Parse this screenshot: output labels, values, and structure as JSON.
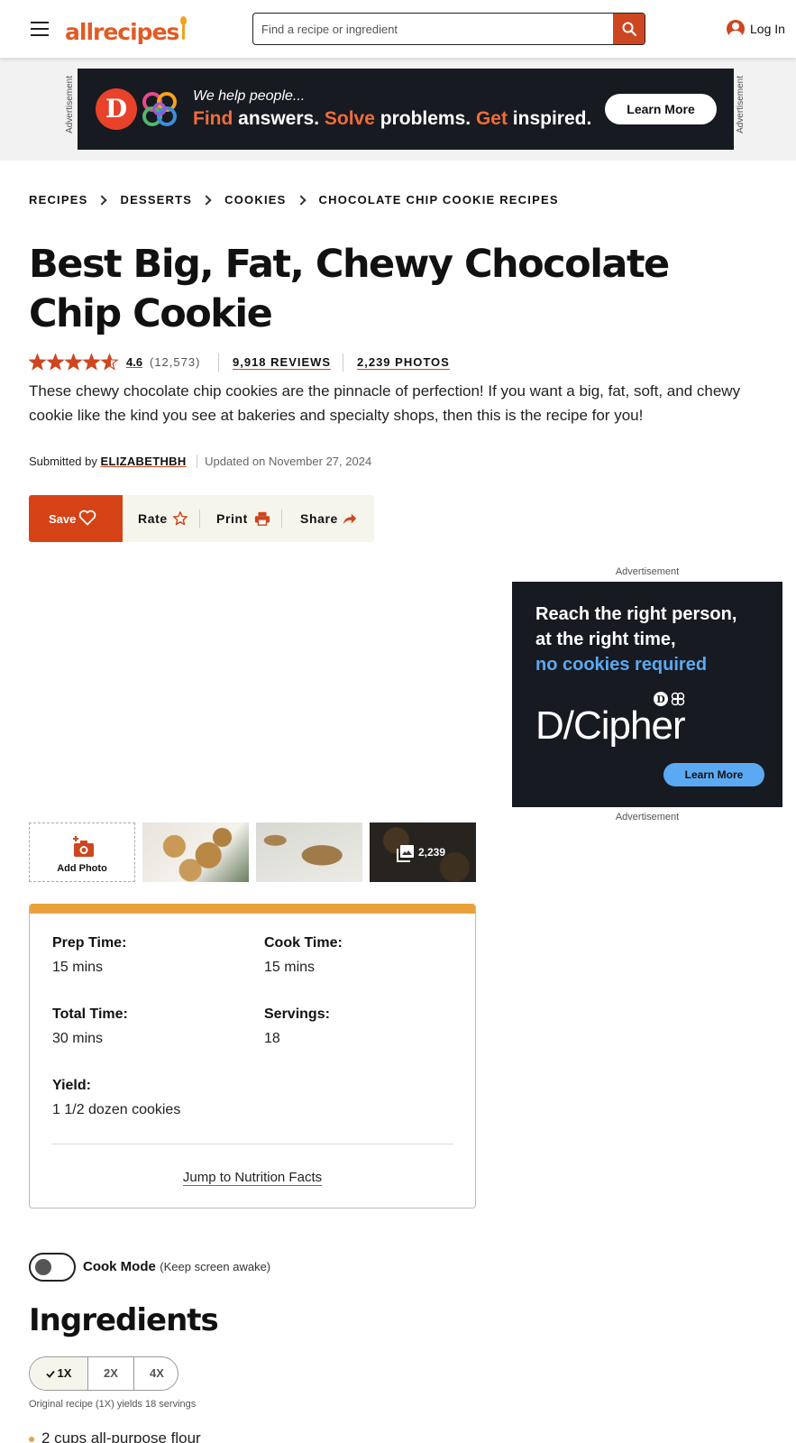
{
  "header": {
    "logo_text": "allrecipes",
    "search_placeholder": "Find a recipe or ingredient",
    "login_label": "Log In"
  },
  "top_ad": {
    "side_label": "Advertisement",
    "logo_letter": "D",
    "line1": "We help people...",
    "line2": {
      "find": "Find",
      "answers": " answers. ",
      "solve": "Solve",
      "problems": " problems. ",
      "get": "Get",
      "inspired": " inspired."
    },
    "button": "Learn More"
  },
  "breadcrumb": [
    "RECIPES",
    "DESSERTS",
    "COOKIES",
    "CHOCOLATE CHIP COOKIE RECIPES"
  ],
  "recipe": {
    "title": "Best Big, Fat, Chewy Chocolate Chip Cookie",
    "rating": "4.6",
    "rating_fraction": 0.92,
    "rating_count": "(12,573)",
    "reviews": "9,918 REVIEWS",
    "photos": "2,239 PHOTOS",
    "description": "These chewy chocolate chip cookies are the pinnacle of perfection! If you want a big, fat, soft, and chewy cookie like the kind you see at bakeries and specialty shops, then this is the recipe for you!",
    "submitted_by": "Submitted by",
    "author": "ELIZABETHBH",
    "updated": "Updated on November 27, 2024"
  },
  "actions": {
    "save": "Save",
    "rate": "Rate",
    "print": "Print",
    "share": "Share"
  },
  "right_ad": {
    "label_top": "Advertisement",
    "headline1": "Reach the right person,",
    "headline2": "at the right time,",
    "headline3": "no cookies required",
    "brand": "D/Cipher",
    "button": "Learn More",
    "label_bottom": "Advertisement"
  },
  "photos": {
    "add_photo": "Add Photo",
    "more_count": "2,239"
  },
  "details": {
    "prep_label": "Prep Time:",
    "prep_value": "15 mins",
    "cook_label": "Cook Time:",
    "cook_value": "15 mins",
    "total_label": "Total Time:",
    "total_value": "30 mins",
    "servings_label": "Servings:",
    "servings_value": "18",
    "yield_label": "Yield:",
    "yield_value": "1 1/2 dozen cookies",
    "nutrition_link": "Jump to Nutrition Facts"
  },
  "cook_mode": {
    "label": "Cook Mode",
    "sub": "(Keep screen awake)",
    "enabled": false
  },
  "ingredients": {
    "heading": "Ingredients",
    "scale_options": [
      "1X",
      "2X",
      "4X"
    ],
    "selected_scale": "1X",
    "original_note": "Original recipe (1X) yields 18 servings",
    "first_item": "2 cups all-purpose flour"
  },
  "colors": {
    "brand_orange": "#ce4620",
    "save_button": "#d54215",
    "details_bar": "#e9a23b",
    "ad_blue": "#5aa9f2",
    "ad_dark": "#171a20"
  },
  "icons": [
    "menu-icon",
    "search-icon",
    "user-icon",
    "star-icon",
    "heart-icon",
    "print-icon",
    "share-icon",
    "camera-icon",
    "gallery-icon",
    "check-icon"
  ]
}
